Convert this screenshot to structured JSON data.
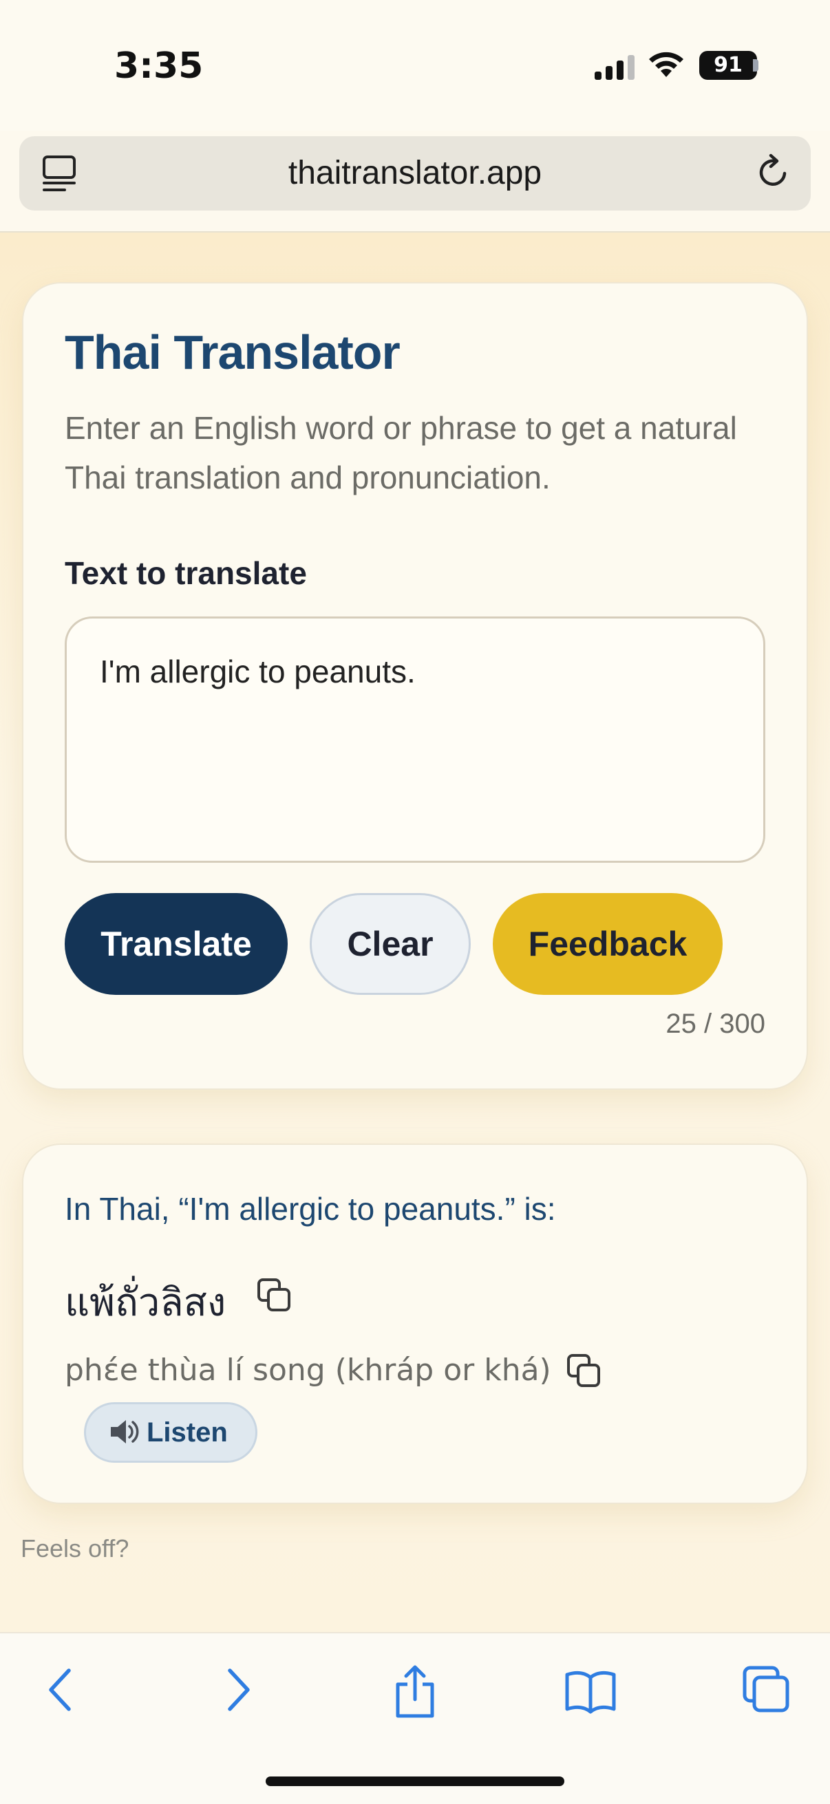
{
  "status_bar": {
    "time": "3:35",
    "battery": "91",
    "icons": [
      "cellular-signal-icon",
      "wifi-icon",
      "battery-icon"
    ]
  },
  "browser": {
    "url": "thaitranslator.app",
    "icons": [
      "tabs-overview-icon",
      "reload-icon"
    ]
  },
  "app": {
    "title": "Thai Translator",
    "subtitle": "Enter an English word or phrase to get a natural Thai translation and pronunciation.",
    "input_label": "Text to translate",
    "input_value": "I'm allergic to peanuts.",
    "buttons": {
      "translate": "Translate",
      "clear": "Clear",
      "feedback": "Feedback"
    },
    "counter": "25 / 300"
  },
  "result": {
    "heading": "In Thai, “I'm allergic to peanuts.” is:",
    "thai": "แพ้ถั่วลิสง",
    "romanization": "phɛ́e thùa lí song (khráp or khá)",
    "listen_label": "Listen",
    "icons": [
      "copy-icon",
      "speaker-icon"
    ]
  },
  "footer_note": "Feels off?",
  "toolbar": {
    "items": [
      "back-icon",
      "forward-icon",
      "share-icon",
      "bookmarks-icon",
      "tabs-icon"
    ]
  },
  "colors": {
    "primary": "#143456",
    "accent": "#e6bb22",
    "heading": "#1d4770",
    "ios_blue": "#2f7de1"
  }
}
